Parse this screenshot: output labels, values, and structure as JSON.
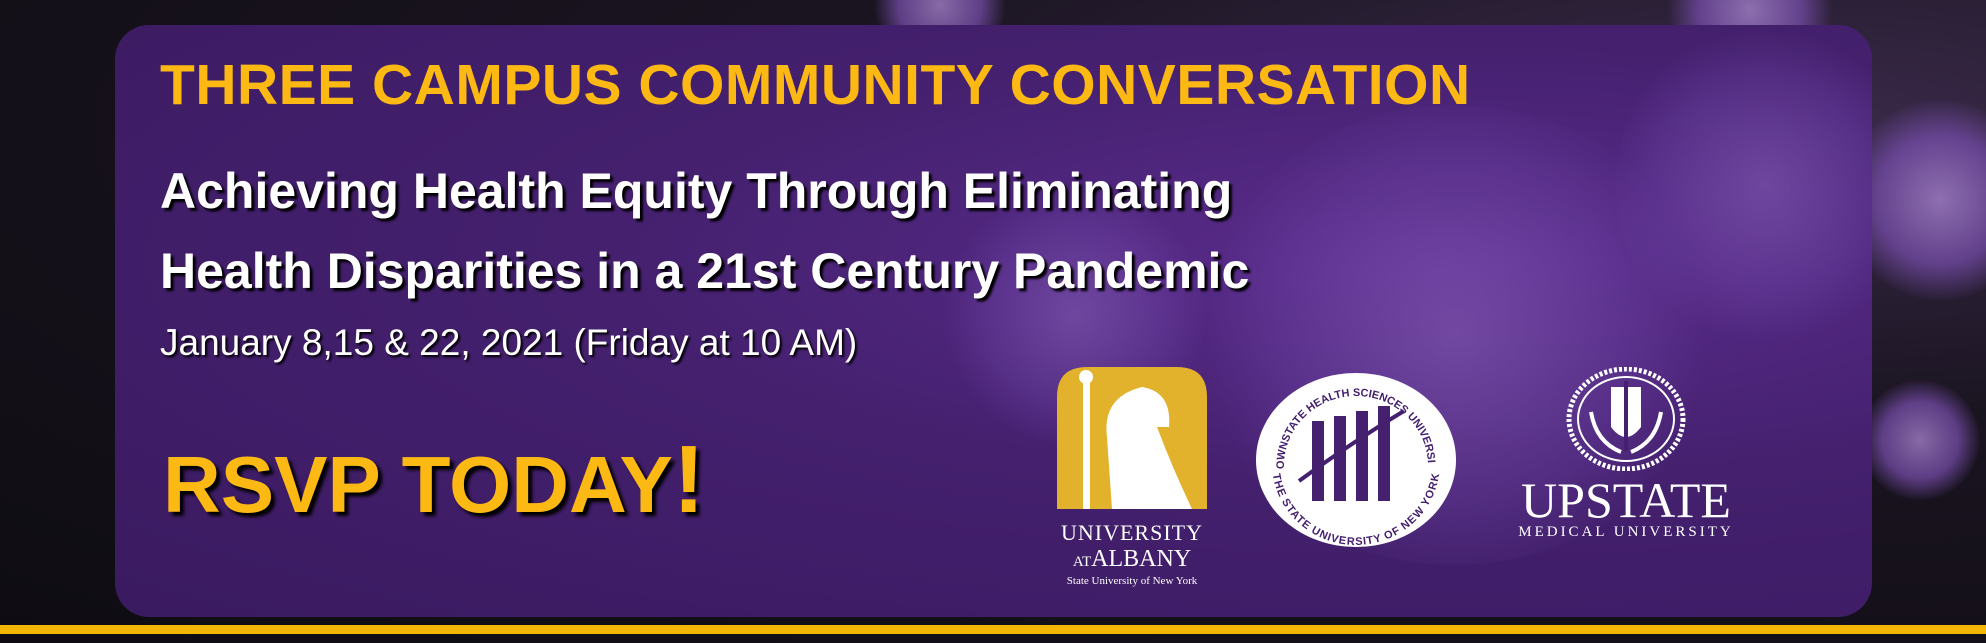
{
  "header": {
    "title": "THREE CAMPUS COMMUNITY CONVERSATION"
  },
  "event": {
    "line1": "Achieving Health Equity Through Eliminating",
    "line2": "Health Disparities in a 21st Century Pandemic",
    "date": "January 8,15 & 22, 2021 (Friday at 10 AM)"
  },
  "cta": {
    "label": "RSVP TODAY",
    "bang": "!"
  },
  "logos": {
    "albany": {
      "line1": "UNIVERSITY",
      "at": "AT",
      "albany": "ALBANY",
      "line3": "State University of New York"
    },
    "downstate": {
      "top": "DOWNSTATE HEALTH SCIENCES UNIVERSITY",
      "bottom": "THE STATE UNIVERSITY OF NEW YORK"
    },
    "upstate": {
      "name": "UPSTATE",
      "sub": "MEDICAL UNIVERSITY"
    }
  },
  "colors": {
    "gold": "#fdb913",
    "purple": "#44206e"
  }
}
